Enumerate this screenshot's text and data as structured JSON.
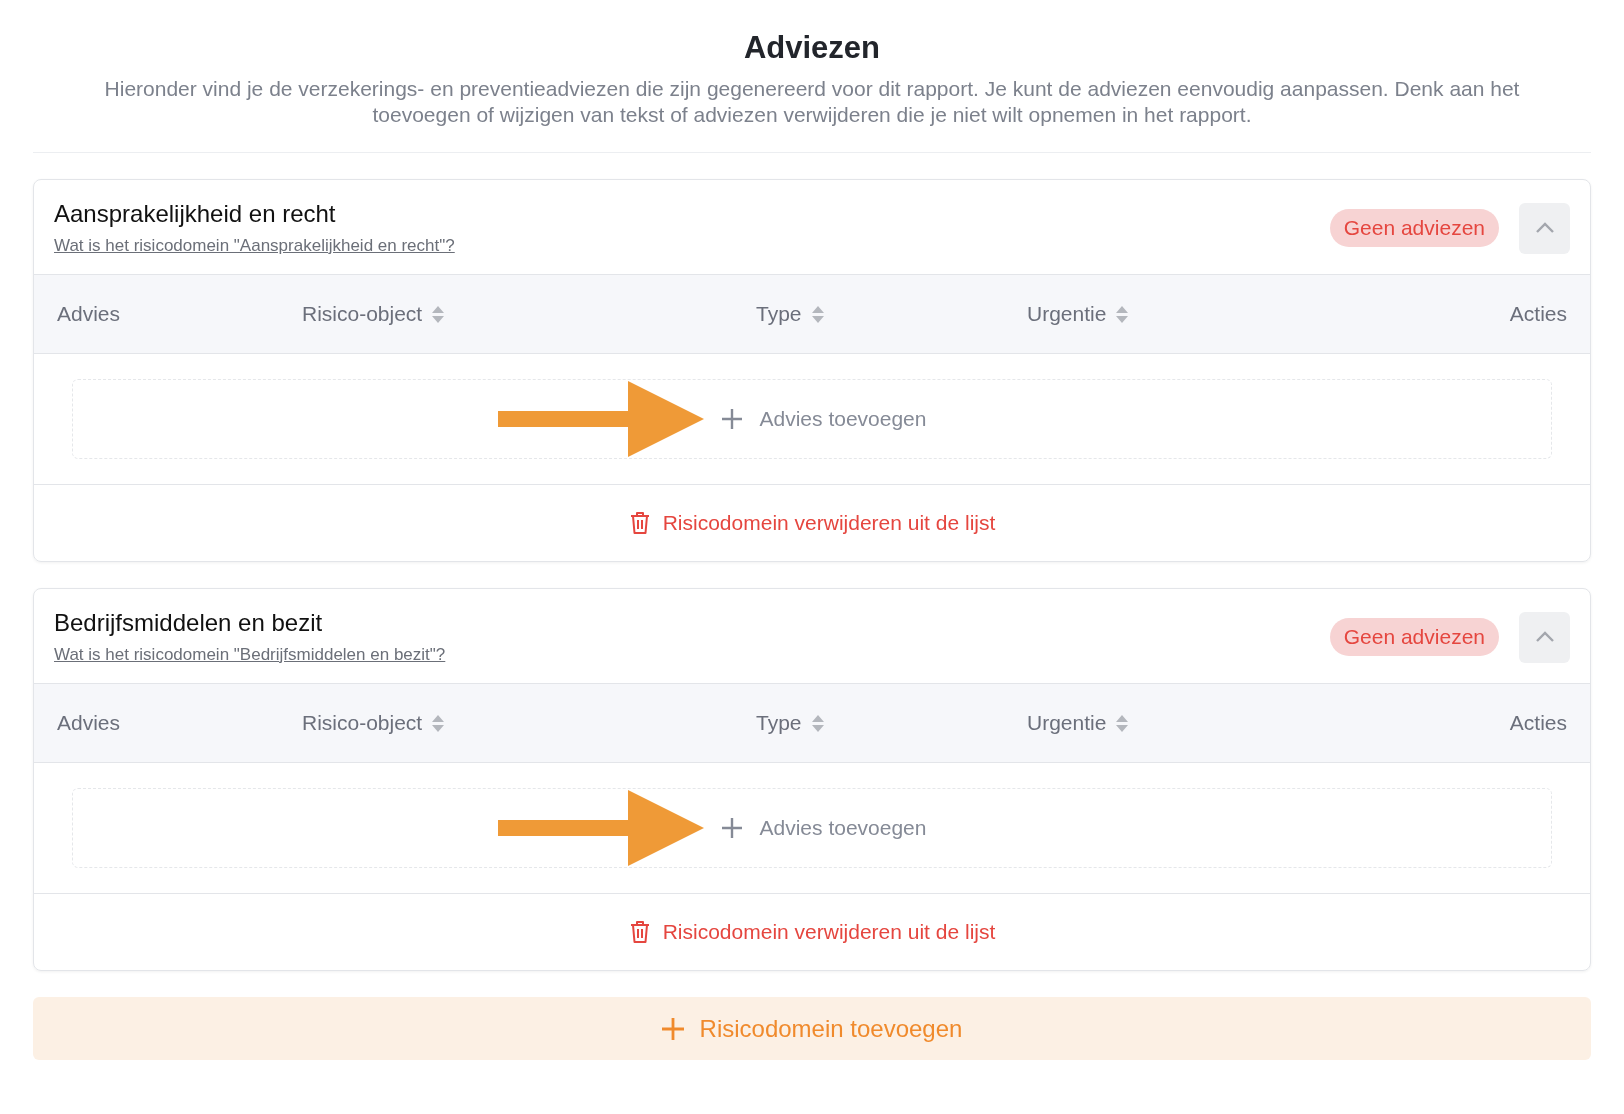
{
  "page": {
    "title": "Adviezen",
    "description": "Hieronder vind je de verzekerings- en preventieadviezen die zijn gegenereerd voor dit rapport. Je kunt de adviezen eenvoudig aanpassen. Denk aan het toevoegen of wijzigen van tekst of adviezen verwijderen die je niet wilt opnemen in het rapport."
  },
  "domains": [
    {
      "title": "Aansprakelijkheid en recht",
      "info_link": "Wat is het risicodomein \"Aansprakelijkheid en recht\"?",
      "badge": "Geen adviezen",
      "expanded": true,
      "columns": [
        {
          "label": "Advies",
          "sortable": false
        },
        {
          "label": "Risico-object",
          "sortable": true
        },
        {
          "label": "Type",
          "sortable": true
        },
        {
          "label": "Urgentie",
          "sortable": true
        },
        {
          "label": "Acties",
          "sortable": false
        }
      ],
      "add_button": "Advies toevoegen",
      "delete_button": "Risicodomein verwijderen uit de lijst"
    },
    {
      "title": "Bedrijfsmiddelen en bezit",
      "info_link": "Wat is het risicodomein \"Bedrijfsmiddelen en bezit\"?",
      "badge": "Geen adviezen",
      "expanded": true,
      "columns": [
        {
          "label": "Advies",
          "sortable": false
        },
        {
          "label": "Risico-object",
          "sortable": true
        },
        {
          "label": "Type",
          "sortable": true
        },
        {
          "label": "Urgentie",
          "sortable": true
        },
        {
          "label": "Acties",
          "sortable": false
        }
      ],
      "add_button": "Advies toevoegen",
      "delete_button": "Risicodomein verwijderen uit de lijst"
    }
  ],
  "add_domain_button": "Risicodomein toevoegen"
}
